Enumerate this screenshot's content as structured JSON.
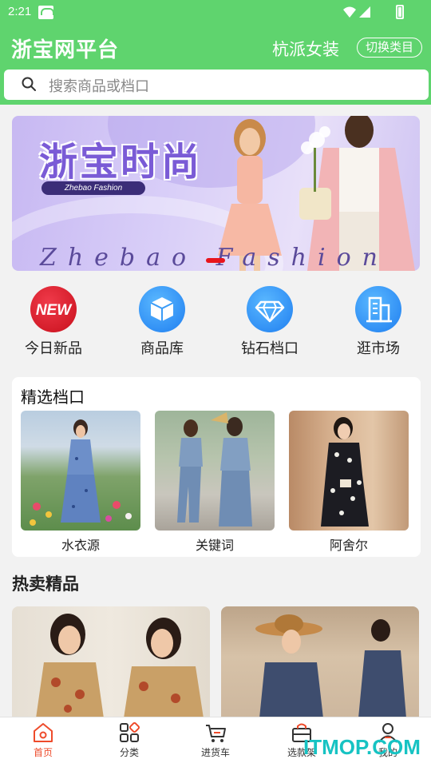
{
  "status_bar": {
    "time": "2:21"
  },
  "header": {
    "title": "浙宝网平台",
    "category": "杭派女装",
    "switch_label": "切换类目"
  },
  "search": {
    "placeholder": "搜索商品或档口"
  },
  "banner": {
    "headline": "浙宝时尚",
    "tag": "Zhebao Fashion",
    "script_text": "Zhebao Fashion",
    "colors": {
      "accent": "#7a5bd6",
      "indicator": "#e8141c"
    }
  },
  "quick_menu": [
    {
      "label": "今日新品",
      "icon": "new-badge-icon"
    },
    {
      "label": "商品库",
      "icon": "box-icon"
    },
    {
      "label": "钻石档口",
      "icon": "diamond-icon"
    },
    {
      "label": "逛市场",
      "icon": "building-icon"
    }
  ],
  "featured": {
    "title": "精选档口",
    "items": [
      {
        "name": "水衣源"
      },
      {
        "name": "关键词"
      },
      {
        "name": "阿舍尔"
      }
    ]
  },
  "hot": {
    "title": "热卖精品"
  },
  "nav": {
    "tabs": [
      {
        "label": "首页",
        "icon": "home-icon",
        "active": true
      },
      {
        "label": "分类",
        "icon": "category-icon",
        "active": false
      },
      {
        "label": "进货车",
        "icon": "cart-icon",
        "active": false
      },
      {
        "label": "选款架",
        "icon": "bag-icon",
        "active": false
      },
      {
        "label": "我的",
        "icon": "user-icon",
        "active": false
      }
    ]
  },
  "watermark": "ITMOP.COM",
  "colors": {
    "brand": "#5fd46e",
    "active_tab": "#ee4b2b"
  }
}
